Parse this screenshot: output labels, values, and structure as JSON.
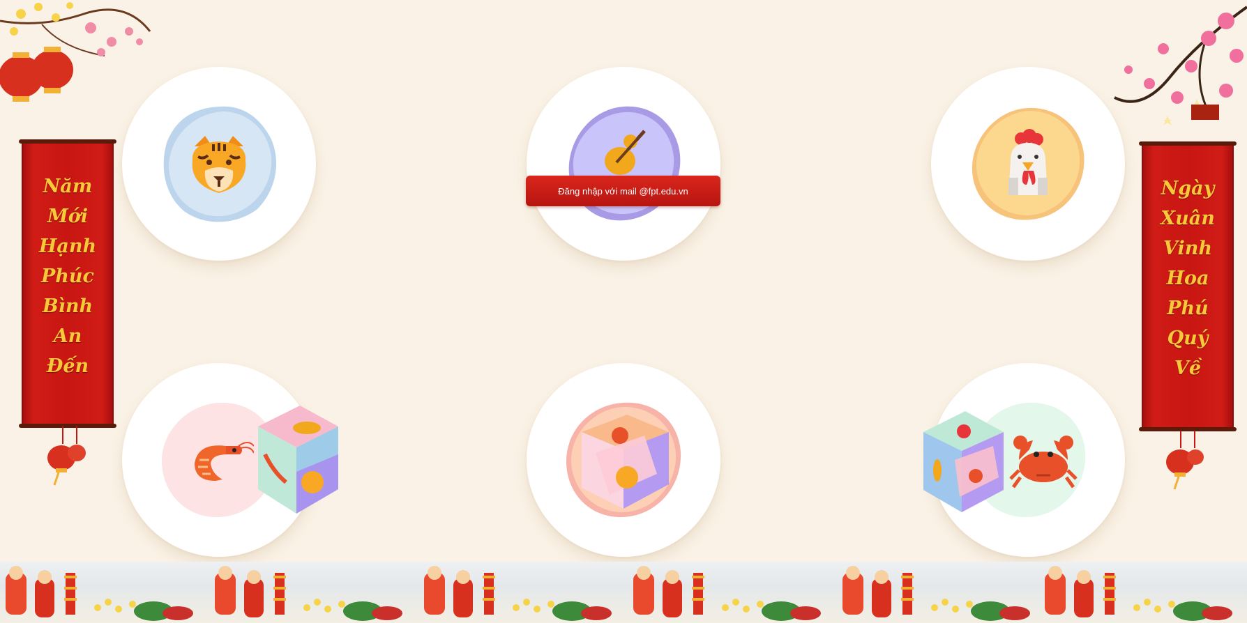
{
  "login": {
    "label": "Đăng nhập với mail @fpt.edu.vn"
  },
  "scroll_left": {
    "words": [
      "Năm",
      "Mới",
      "Hạnh",
      "Phúc",
      "Bình",
      "An",
      "Đến"
    ]
  },
  "scroll_right": {
    "words": [
      "Ngày",
      "Xuân",
      "Vinh",
      "Hoa",
      "Phú",
      "Quý",
      "Về"
    ]
  },
  "plates": [
    {
      "animal": "tiger-icon",
      "blob_color": "#d6e6f4"
    },
    {
      "animal": "gourd-icon",
      "blob_color": "#c9c5fb"
    },
    {
      "animal": "rooster-icon",
      "blob_color": "#fcd88f"
    },
    {
      "animal": "shrimp-icon",
      "blob_color": "#fde3e3"
    },
    {
      "animal": "dice-cube-icon",
      "blob_color": "#fdd0b6"
    },
    {
      "animal": "crab-icon",
      "blob_color": "#e3f7ea"
    }
  ],
  "colors": {
    "background": "#faf2e6",
    "scroll_red": "#c81612",
    "gold_text": "#f7c93a",
    "button_red": "#c81c14"
  }
}
